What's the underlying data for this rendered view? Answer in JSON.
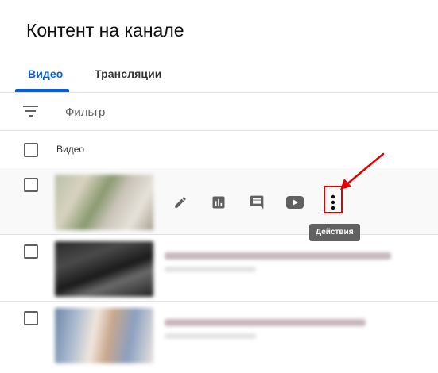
{
  "page": {
    "title": "Контент на канале"
  },
  "tabs": [
    {
      "label": "Видео",
      "active": true
    },
    {
      "label": "Трансляции",
      "active": false
    }
  ],
  "filter": {
    "placeholder": "Фильтр",
    "icon": "filter-icon"
  },
  "table": {
    "header": {
      "video_label": "Видео"
    },
    "rows": [
      {
        "thumbnail": "blurred-thumbnail",
        "hovered": true
      },
      {
        "thumbnail": "blurred-thumbnail",
        "hovered": false
      },
      {
        "thumbnail": "blurred-thumbnail",
        "hovered": false
      }
    ]
  },
  "row_actions": [
    {
      "icon": "pencil-icon",
      "name": "edit"
    },
    {
      "icon": "analytics-icon",
      "name": "analytics"
    },
    {
      "icon": "comments-icon",
      "name": "comments"
    },
    {
      "icon": "youtube-play-icon",
      "name": "view-on-youtube"
    },
    {
      "icon": "more-vert-icon",
      "name": "actions"
    }
  ],
  "tooltip": {
    "text": "Действия"
  },
  "colors": {
    "accent": "#065fd4",
    "annotation": "#e00000",
    "tooltip_bg": "#616161",
    "row_hover": "#f9f9f9"
  }
}
